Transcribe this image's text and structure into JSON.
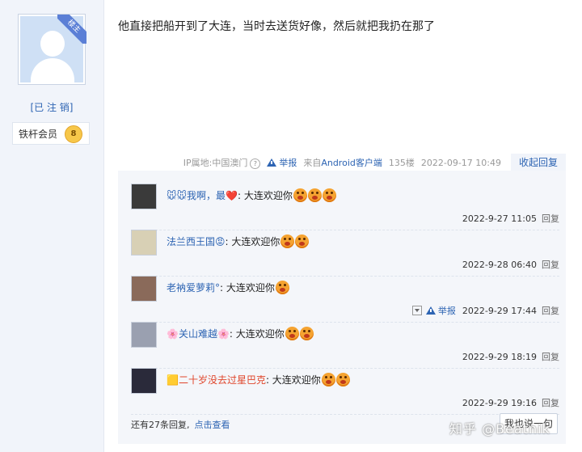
{
  "author": {
    "ribbon": "楼主",
    "username": "[已 注 销]",
    "badge_title": "铁杆会员",
    "badge_level": "8"
  },
  "post": {
    "content": "他直接把船开到了大连，当时去送货好像，然后就把我扔在那了",
    "ip": "IP属地:中国澳门",
    "report": "举报",
    "client": "来自Android客户端",
    "floor": "135楼",
    "time": "2022-09-17 10:49",
    "collapse": "收起回复"
  },
  "replies": [
    {
      "prefix": "🐭🐭",
      "name": "我啊，最",
      "suffix": "❤️",
      "text": ": 大连欢迎你",
      "emoji_count": 3,
      "time": "2022-9-27 11:05",
      "reply": "回复",
      "name_color": "blue"
    },
    {
      "prefix": "",
      "name": "法兰西王国",
      "suffix": "😡",
      "text": ": 大连欢迎你",
      "emoji_count": 2,
      "time": "2022-9-28 06:40",
      "reply": "回复",
      "name_color": "blue"
    },
    {
      "prefix": "",
      "name": "老衲爱萝莉°",
      "suffix": "",
      "text": " : 大连欢迎你",
      "emoji_count": 1,
      "time": "2022-9-29 17:44",
      "reply": "回复",
      "report": "举报",
      "name_color": "blue"
    },
    {
      "prefix": "🌸",
      "name": "关山难越",
      "suffix": "🌸",
      "text": ": 大连欢迎你",
      "emoji_count": 2,
      "time": "2022-9-29 18:19",
      "reply": "回复",
      "name_color": "blue"
    },
    {
      "prefix": "🟨",
      "name": "二十岁没去过星巴克",
      "suffix": "",
      "text": ": 大连欢迎你",
      "emoji_count": 2,
      "time": "2022-9-29 19:16",
      "reply": "回复",
      "name_color": "red"
    }
  ],
  "footer": {
    "more_text": "还有27条回复,",
    "more_link": "点击查看",
    "say_button": "我也说一句"
  },
  "watermark": "知乎 @Beatnik",
  "colors": {
    "link": "#2d64b3",
    "reply_bg": "#f4f6fa",
    "author_bg": "#f1f4fa"
  }
}
